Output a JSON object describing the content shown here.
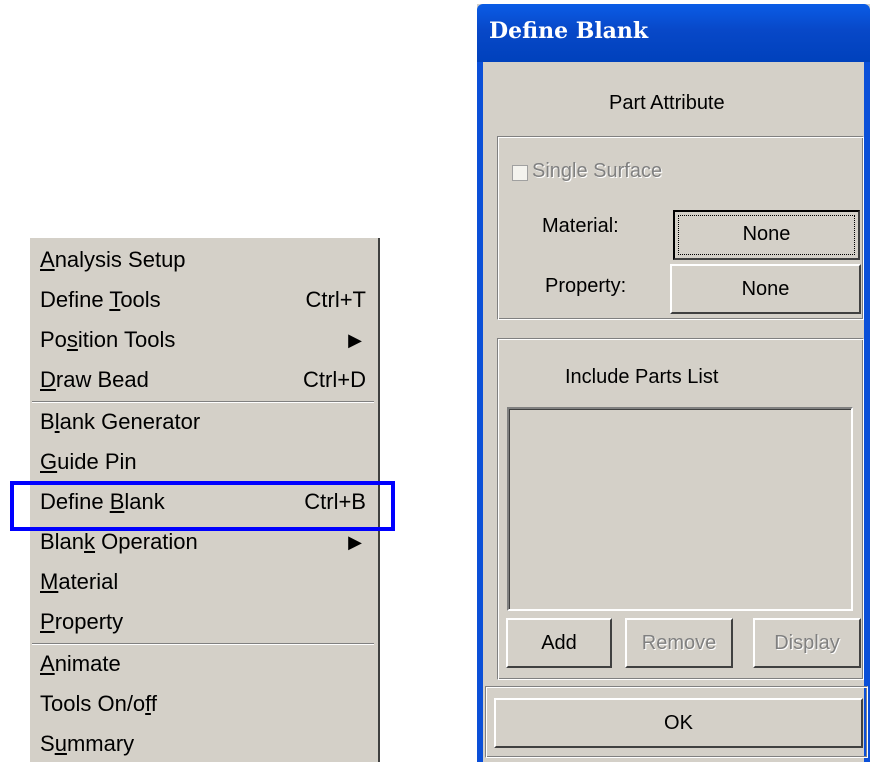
{
  "menu": {
    "items": [
      {
        "pre": "",
        "ul": "A",
        "post": "nalysis Setup",
        "shortcut": "",
        "submenu": false
      },
      {
        "pre": "Define ",
        "ul": "T",
        "post": "ools",
        "shortcut": "Ctrl+T",
        "submenu": false
      },
      {
        "pre": "Po",
        "ul": "s",
        "post": "ition Tools",
        "shortcut": "",
        "submenu": true
      },
      {
        "pre": "",
        "ul": "D",
        "post": "raw Bead",
        "shortcut": "Ctrl+D",
        "submenu": false
      },
      {
        "pre": "B",
        "ul": "l",
        "post": "ank Generator",
        "shortcut": "",
        "submenu": false
      },
      {
        "pre": "",
        "ul": "G",
        "post": "uide Pin",
        "shortcut": "",
        "submenu": false
      },
      {
        "pre": "Define ",
        "ul": "B",
        "post": "lank",
        "shortcut": "Ctrl+B",
        "submenu": false
      },
      {
        "pre": "Blan",
        "ul": "k",
        "post": " Operation",
        "shortcut": "",
        "submenu": true
      },
      {
        "pre": "",
        "ul": "M",
        "post": "aterial",
        "shortcut": "",
        "submenu": false
      },
      {
        "pre": "",
        "ul": "P",
        "post": "roperty",
        "shortcut": "",
        "submenu": false
      },
      {
        "pre": "",
        "ul": "A",
        "post": "nimate",
        "shortcut": "",
        "submenu": false
      },
      {
        "pre": "Tools On/o",
        "ul": "f",
        "post": "f",
        "shortcut": "",
        "submenu": false
      },
      {
        "pre": "S",
        "ul": "u",
        "post": "mmary",
        "shortcut": "",
        "submenu": false
      }
    ],
    "submenu_arrow": "▶",
    "highlighted_item": "Define Blank",
    "highlight_color": "#0000ff"
  },
  "dialog": {
    "title": "Define Blank",
    "part_attribute_heading": "Part Attribute",
    "single_surface_label": "Single Surface",
    "single_surface_checked": false,
    "material_label": "Material:",
    "material_value": "None",
    "property_label": "Property:",
    "property_value": "None",
    "include_parts_heading": "Include Parts List",
    "add_label": "Add",
    "remove_label": "Remove",
    "display_label": "Display",
    "ok_label": "OK",
    "title_bar_color": "#0a5ce6"
  }
}
